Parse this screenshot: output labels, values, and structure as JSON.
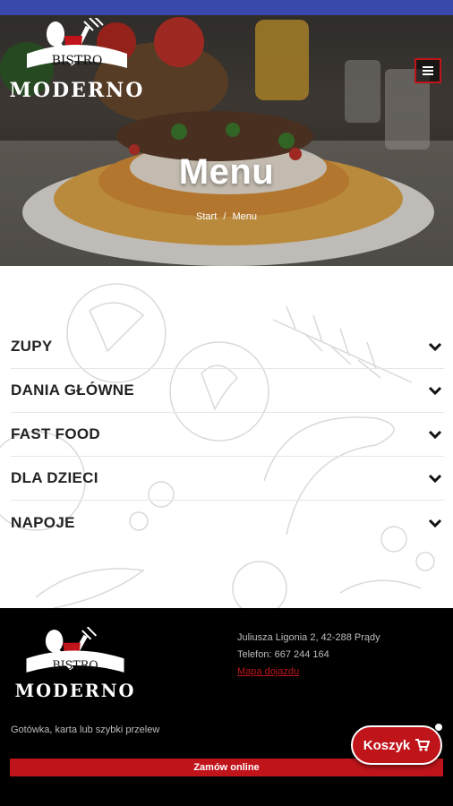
{
  "brand": {
    "top_word": "BISTRO",
    "bottom_word": "MODERNO"
  },
  "header": {
    "menu_icon": "hamburger-icon"
  },
  "hero": {
    "title": "Menu",
    "breadcrumb": {
      "home": "Start",
      "separator": "/",
      "current": "Menu"
    }
  },
  "categories": [
    {
      "label": "ZUPY"
    },
    {
      "label": "DANIA GŁÓWNE"
    },
    {
      "label": "FAST FOOD"
    },
    {
      "label": "DLA DZIECI"
    },
    {
      "label": "NAPOJE"
    }
  ],
  "footer": {
    "address": "Juliusza Ligonia 2, 42-288 Prądy",
    "phone": "Telefon: 667 244 164",
    "map_link": "Mapa dojazdu",
    "payment": "Gotówka, karta lub szybki przelew",
    "order_button": "Zamów online"
  },
  "cart": {
    "label": "Koszyk",
    "icon": "cart-icon"
  },
  "colors": {
    "accent": "#c0141b",
    "status_bar": "#3949ab"
  }
}
